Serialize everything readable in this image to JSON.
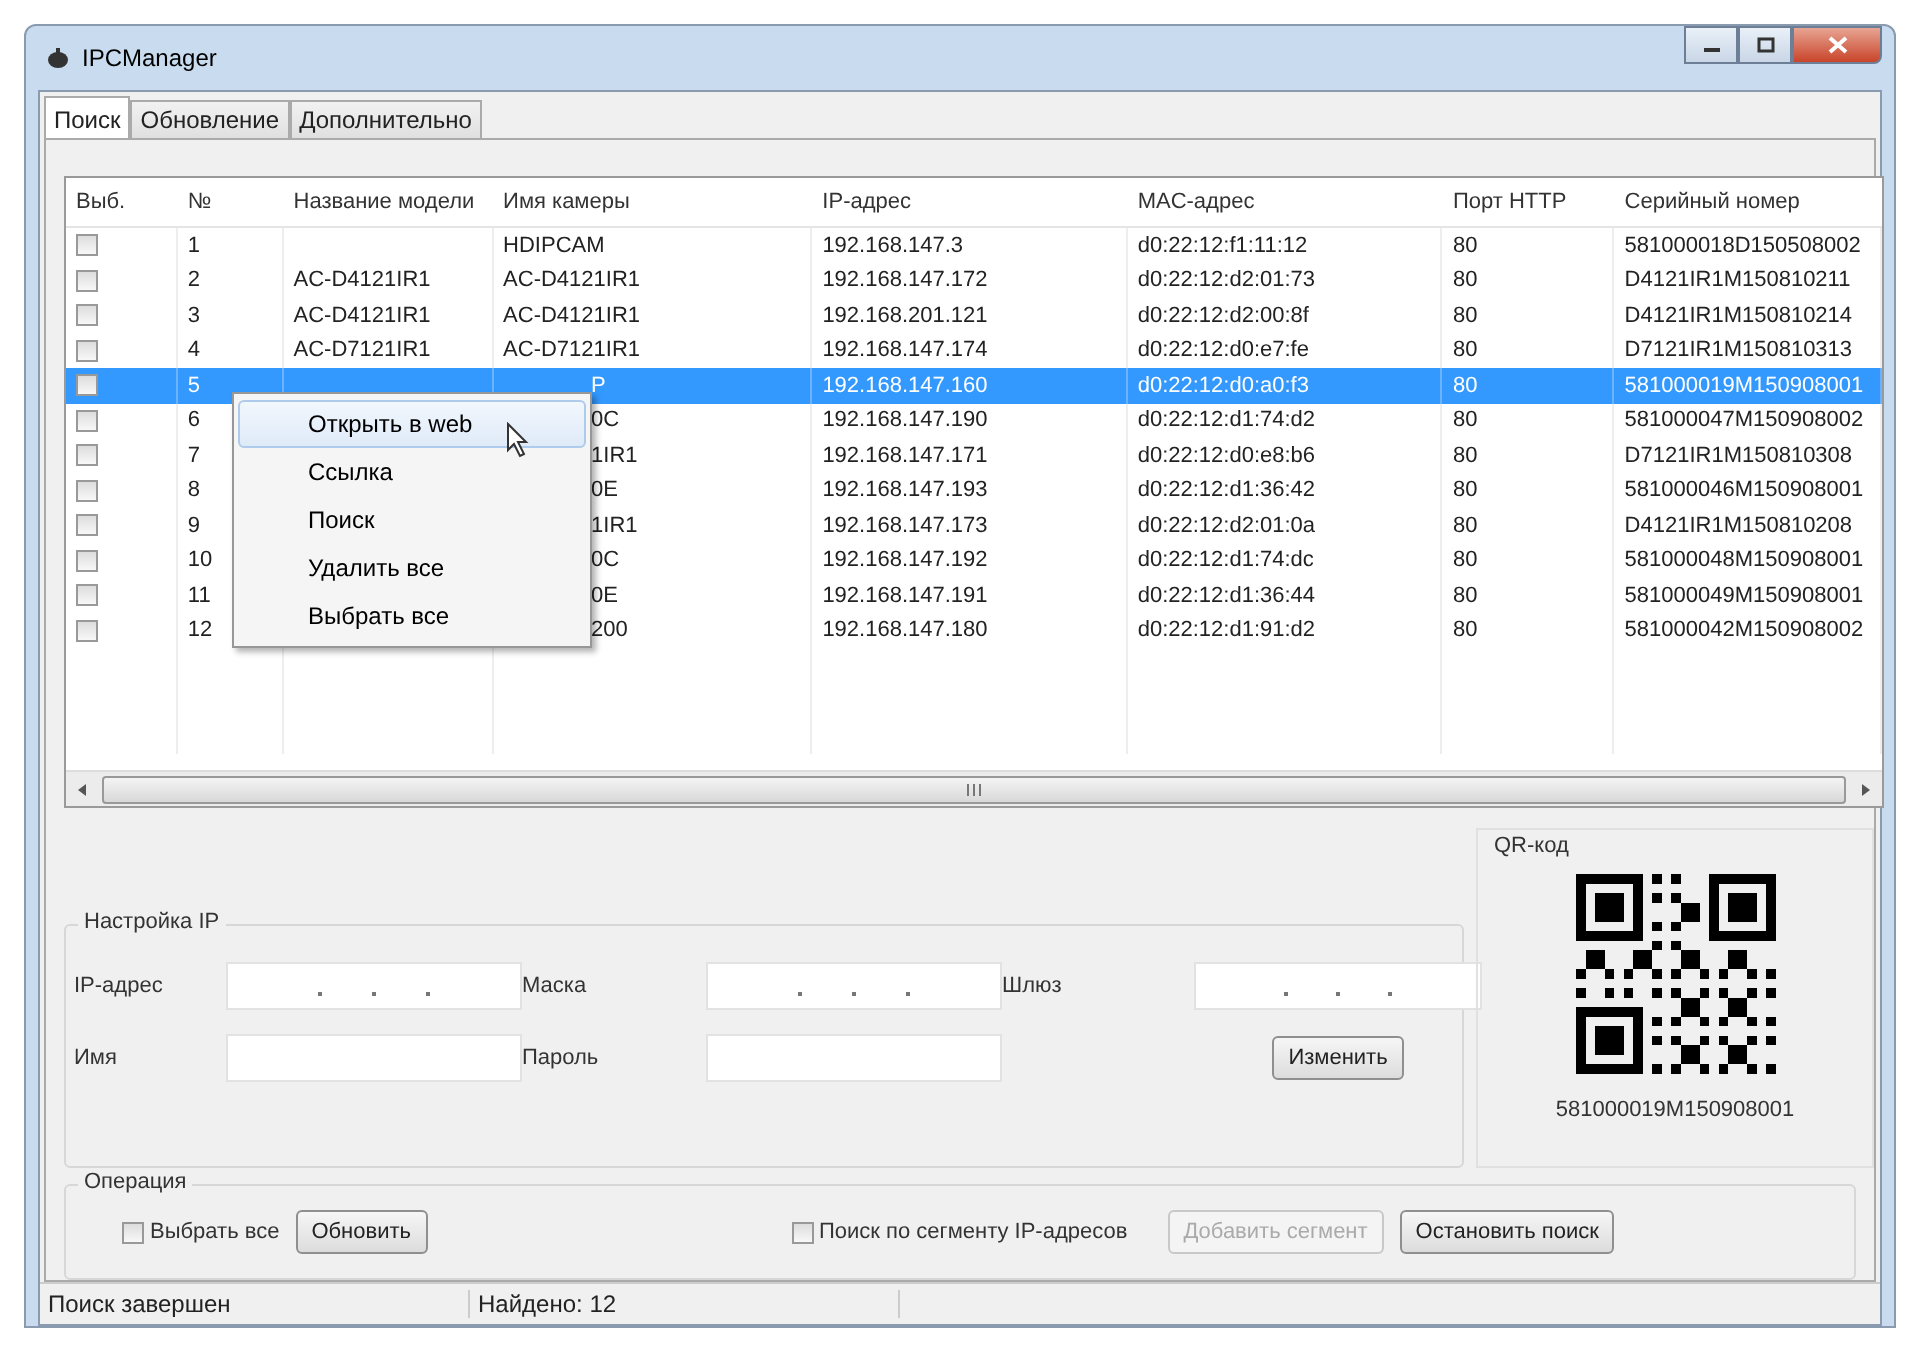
{
  "window": {
    "title": "IPCManager"
  },
  "tabs": [
    {
      "label": "Поиск",
      "selected": true
    },
    {
      "label": "Обновление",
      "selected": false
    },
    {
      "label": "Дополнительно",
      "selected": false
    }
  ],
  "table": {
    "columns": [
      "Выб.",
      "№",
      "Название модели",
      "Имя камеры",
      "IP-адрес",
      "MAC-адрес",
      "Порт HTTP",
      "Серийный номер"
    ],
    "rows": [
      {
        "checked": false,
        "selected": false,
        "number": "1",
        "camera": "HDIPCAM",
        "ip": "192.168.147.3",
        "mac": "d0:22:12:f1:11:12",
        "port": "80",
        "serial": "581000018D150508002"
      },
      {
        "checked": false,
        "selected": false,
        "number": "2",
        "model": "AC-D4121IR1",
        "camera": "AC-D4121IR1",
        "ip": "192.168.147.172",
        "mac": "d0:22:12:d2:01:73",
        "port": "80",
        "serial": "D4121IR1M150810211"
      },
      {
        "checked": false,
        "selected": false,
        "number": "3",
        "model": "AC-D4121IR1",
        "camera": "AC-D4121IR1",
        "ip": "192.168.201.121",
        "mac": "d0:22:12:d2:00:8f",
        "port": "80",
        "serial": "D4121IR1M150810214"
      },
      {
        "checked": false,
        "selected": false,
        "number": "4",
        "model": "AC-D7121IR1",
        "camera": "AC-D7121IR1",
        "ip": "192.168.147.174",
        "mac": "d0:22:12:d0:e7:fe",
        "port": "80",
        "serial": "D7121IR1M150810313"
      },
      {
        "checked": false,
        "selected": true,
        "number": "5",
        "camera": "P",
        "ip": "192.168.147.160",
        "mac": "d0:22:12:d0:a0:f3",
        "port": "80",
        "serial": "581000019M150908001"
      },
      {
        "checked": false,
        "selected": false,
        "number": "6",
        "camera": "0C",
        "ip": "192.168.147.190",
        "mac": "d0:22:12:d1:74:d2",
        "port": "80",
        "serial": "581000047M150908002"
      },
      {
        "checked": false,
        "selected": false,
        "number": "7",
        "camera": "1IR1",
        "ip": "192.168.147.171",
        "mac": "d0:22:12:d0:e8:b6",
        "port": "80",
        "serial": "D7121IR1M150810308"
      },
      {
        "checked": false,
        "selected": false,
        "number": "8",
        "camera": "0E",
        "ip": "192.168.147.193",
        "mac": "d0:22:12:d1:36:42",
        "port": "80",
        "serial": "581000046M150908001"
      },
      {
        "checked": false,
        "selected": false,
        "number": "9",
        "camera": "1IR1",
        "ip": "192.168.147.173",
        "mac": "d0:22:12:d2:01:0a",
        "port": "80",
        "serial": "D4121IR1M150810208"
      },
      {
        "checked": false,
        "selected": false,
        "number": "10",
        "camera": "0C",
        "ip": "192.168.147.192",
        "mac": "d0:22:12:d1:74:dc",
        "port": "80",
        "serial": "581000048M150908001"
      },
      {
        "checked": false,
        "selected": false,
        "number": "11",
        "camera": "0E",
        "ip": "192.168.147.191",
        "mac": "d0:22:12:d1:36:44",
        "port": "80",
        "serial": "581000049M150908001"
      },
      {
        "checked": false,
        "selected": false,
        "number": "12",
        "camera": "200",
        "ip": "192.168.147.180",
        "mac": "d0:22:12:d1:91:d2",
        "port": "80",
        "serial": "581000042M150908002"
      }
    ]
  },
  "context_menu": {
    "items": [
      {
        "label": "Открыть в web",
        "selected": true
      },
      {
        "label": "Ссылка",
        "selected": false
      },
      {
        "label": "Поиск",
        "selected": false
      },
      {
        "label": "Удалить все",
        "selected": false
      },
      {
        "label": "Выбрать все",
        "selected": false
      }
    ]
  },
  "ip_settings": {
    "title": "Настройка IP",
    "ip_label": "IP-адрес",
    "mask_label": "Маска",
    "gateway_label": "Шлюз",
    "name_label": "Имя",
    "password_label": "Пароль",
    "change_button": "Изменить"
  },
  "qr": {
    "title": "QR-код",
    "serial": "581000019M150908001"
  },
  "operation": {
    "title": "Операция",
    "select_all": {
      "label": "Выбрать все",
      "checked": false
    },
    "refresh_button": "Обновить",
    "segment_search": {
      "label": "Поиск по сегменту IP-адресов",
      "checked": false
    },
    "add_segment_button": {
      "label": "Добавить сегмент",
      "disabled": true
    },
    "stop_button": "Остановить поиск"
  },
  "status_bar": [
    "Поиск завершен",
    "Найдено: 12"
  ]
}
